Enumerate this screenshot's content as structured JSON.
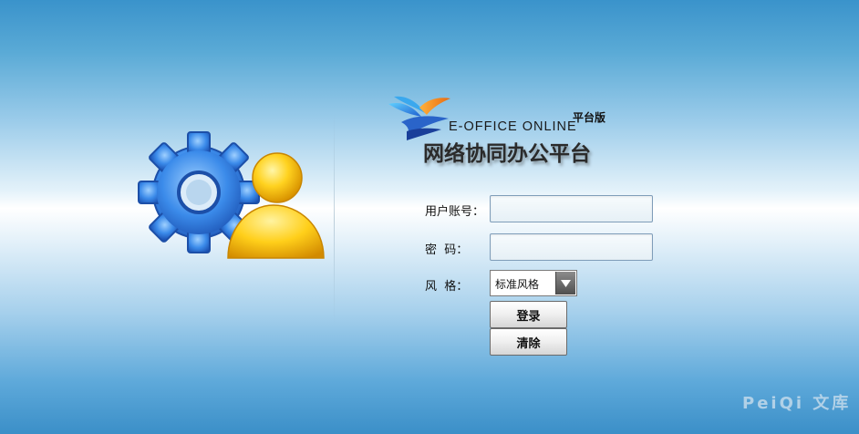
{
  "logo": {
    "english_name": "E-OFFICE ONLINE",
    "edition": "平台版",
    "chinese_name": "网络协同办公平台"
  },
  "form": {
    "username_label": "用户账号：",
    "username_value": "",
    "password_label": "密  码：",
    "password_value": "",
    "style_label": "风  格：",
    "style_selected": "标准风格",
    "login_button": "登录",
    "clear_button": "清除"
  },
  "icons": {
    "hero": "gear-user-icon",
    "logo_bird": "bird-logo-icon",
    "dropdown": "triangle-down-icon"
  },
  "colors": {
    "background_blue": "#3a93cb",
    "gear_blue": "#2f7bd6",
    "user_yellow": "#f6c21a"
  },
  "watermark": "PeiQi 文库"
}
